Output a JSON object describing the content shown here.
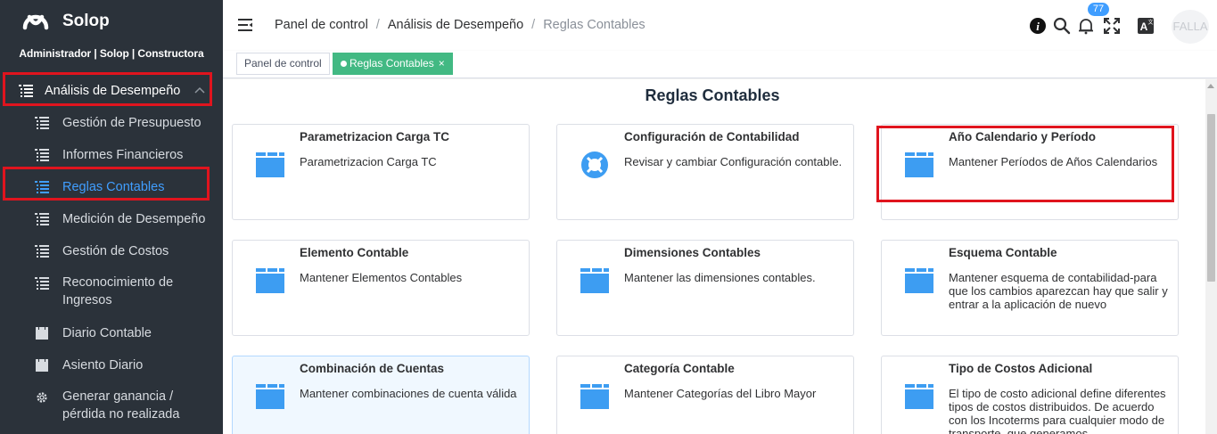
{
  "brand": {
    "name": "Solop",
    "subtitle": "Administrador | Solop | Constructora"
  },
  "sidebar": {
    "parent": {
      "label": "Análisis de Desempeño",
      "icon": "list-icon",
      "expanded": true
    },
    "items": [
      {
        "label": "Gestión de Presupuesto",
        "icon": "list-icon",
        "active": false
      },
      {
        "label": "Informes Financieros",
        "icon": "list-icon",
        "active": false
      },
      {
        "label": "Reglas Contables",
        "icon": "list-icon",
        "active": true
      },
      {
        "label": "Medición de Desempeño",
        "icon": "list-icon",
        "active": false
      },
      {
        "label": "Gestión de Costos",
        "icon": "list-icon",
        "active": false
      },
      {
        "label": "Reconocimiento de Ingresos",
        "icon": "list-icon",
        "active": false
      },
      {
        "label": "Diario Contable",
        "icon": "folder-icon",
        "active": false
      },
      {
        "label": "Asiento Diario",
        "icon": "folder-icon",
        "active": false
      },
      {
        "label": "Generar ganancia / pérdida no realizada",
        "icon": "gear-icon",
        "active": false
      }
    ]
  },
  "breadcrumb": {
    "items": [
      "Panel de control",
      "Análisis de Desempeño",
      "Reglas Contables"
    ],
    "separator": "/"
  },
  "header": {
    "notifications_count": "77",
    "avatar_text": "FALLA",
    "icons": [
      "info-icon",
      "search-icon",
      "bell-icon",
      "fullscreen-icon",
      "translate-icon"
    ]
  },
  "tags": [
    {
      "label": "Panel de control",
      "active": false
    },
    {
      "label": "Reglas Contables",
      "active": true,
      "close": "×"
    }
  ],
  "page": {
    "title": "Reglas Contables",
    "cards": [
      {
        "title": "Parametrizacion Carga TC",
        "description": "Parametrizacion Carga TC",
        "icon": "folder-icon"
      },
      {
        "title": "Configuración de Contabilidad",
        "description": "Revisar y cambiar Configuración contable.",
        "icon": "lifebuoy-icon"
      },
      {
        "title": "Año Calendario y Período",
        "description": "Mantener Períodos de Años Calendarios",
        "icon": "folder-icon"
      },
      {
        "title": "Elemento Contable",
        "description": "Mantener Elementos Contables",
        "icon": "folder-icon"
      },
      {
        "title": "Dimensiones Contables",
        "description": "Mantener las dimensiones contables.",
        "icon": "folder-icon"
      },
      {
        "title": "Esquema Contable",
        "description": "Mantener esquema de contabilidad-para que los cambios aparezcan hay que salir y entrar a la aplicación de nuevo",
        "icon": "folder-icon"
      },
      {
        "title": "Combinación de Cuentas",
        "description": "Mantener combinaciones de cuenta válida",
        "icon": "folder-icon"
      },
      {
        "title": "Categoría Contable",
        "description": "Mantener Categorías del Libro Mayor",
        "icon": "folder-icon"
      },
      {
        "title": "Tipo de Costos Adicional",
        "description": "El tipo de costo adicional define diferentes tipos de costos distribuidos. De acuerdo con los Incoterms para cualquier modo de transporte, que generamos",
        "icon": "folder-icon"
      }
    ]
  },
  "colors": {
    "sidebar_bg": "#2b323a",
    "accent": "#409eff",
    "active_tag": "#42b983",
    "folder_icon": "#3d9df2",
    "highlight_border": "#e0141e"
  }
}
